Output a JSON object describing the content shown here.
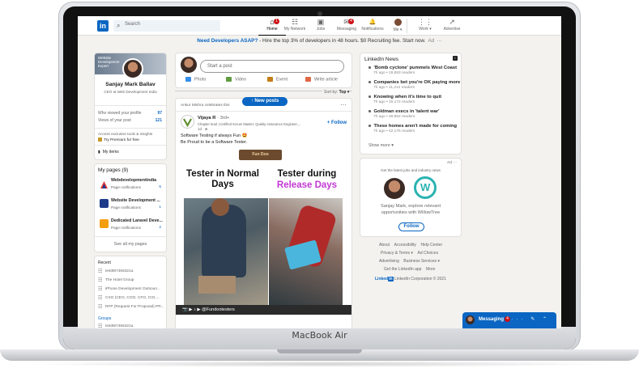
{
  "device": {
    "label": "MacBook Air"
  },
  "nav": {
    "logo": "in",
    "search_placeholder": "Search",
    "items": [
      {
        "label": "Home",
        "glyph": "⌂",
        "badge": "1"
      },
      {
        "label": "My Network",
        "glyph": "☷",
        "badge": ""
      },
      {
        "label": "Jobs",
        "glyph": "▣",
        "badge": ""
      },
      {
        "label": "Messaging",
        "glyph": "✉",
        "badge": "4"
      },
      {
        "label": "Notifications",
        "glyph": "🔔",
        "badge": ""
      },
      {
        "label": "Me ▾",
        "glyph": "",
        "badge": ""
      },
      {
        "label": "Work ▾",
        "glyph": "⋮⋮",
        "badge": ""
      },
      {
        "label": "Advertise",
        "glyph": "↗",
        "badge": ""
      }
    ]
  },
  "adline": {
    "link": "Need Developers ASAP?",
    "text": " - Hire the top 3% of developers in 48 hours. $0 Recruiting fee. Start now.",
    "ad": "Ad",
    "dots": "···"
  },
  "profile": {
    "cover_text": "Website Development Expert",
    "name": "Sanjay Mark Ballav",
    "headline": "CEO at Web Development India",
    "viewed_label": "Who viewed your profile",
    "viewed_value": "97",
    "views_label": "Views of your post",
    "views_value": "121",
    "premium_line1": "Access exclusive tools & insights",
    "premium_line2": "Try Premium for free",
    "my_items": "My items"
  },
  "pages": {
    "title": "My pages (9)",
    "items": [
      {
        "name": "Webdevelopmentindia",
        "sub": "Page notifications",
        "count": "5",
        "color": "#e53935"
      },
      {
        "name": "Website Development ...",
        "sub": "Page notifications",
        "count": "1",
        "color": "#1e3a8a"
      },
      {
        "name": "Dedicated Laravel Deve...",
        "sub": "Page notifications",
        "count": "2",
        "color": "#f59e0b"
      }
    ],
    "see_all": "See all my pages"
  },
  "recent": {
    "title": "Recent",
    "items": [
      "test987456321a",
      "The Hotel Group",
      "iPhone Development Outsoun...",
      "CXO (CEO, COO, CFO, CIO,...",
      "RFP (Request For Proposal) PR..."
    ],
    "groups_title": "Groups",
    "groups_items": [
      "test987456321a"
    ]
  },
  "share": {
    "start_post": "Start a post",
    "actions": [
      {
        "label": "Photo",
        "color": "#378fe9"
      },
      {
        "label": "Video",
        "color": "#5f9b41"
      },
      {
        "label": "Event",
        "color": "#c37d16"
      },
      {
        "label": "Write article",
        "color": "#e06847"
      }
    ]
  },
  "sort": {
    "label": "Sort by:",
    "value": "Top ▾"
  },
  "new_posts": "↑ New posts",
  "post": {
    "celebrates": "Ankur Mishra celebrates this",
    "dots": "···",
    "author": "Vijaya R",
    "degree": " · 3rd+",
    "author_sub": "Chapter lead ,Certified Scrum Master, Quality Assurance Engineer,...",
    "time": "1d · ⊕",
    "follow": "+ Follow",
    "text1": "Software Testing if always Fun 🤩",
    "text2": "Be Proud to be a Software Tester.",
    "fun_badge": "Fun Doo",
    "left_heading": "Tester in Normal Days",
    "right_heading_1": "Tester during",
    "right_heading_2": "Release Days",
    "footer": "📷 ▶ ♪ ▶ @Fundootesters"
  },
  "news": {
    "title": "LinkedIn News",
    "items": [
      {
        "headline": "'Bomb cyclone' pummels West Coast",
        "meta": "7h ago • 19,893 readers"
      },
      {
        "headline": "Companies bet you're OK paying more",
        "meta": "7h ago • 11,212 readers"
      },
      {
        "headline": "Knowing when it's time to quit",
        "meta": "7h ago • 16,172 readers"
      },
      {
        "headline": "Goldman execs in 'talent war'",
        "meta": "7h ago • 48,862 readers"
      },
      {
        "headline": "These homes aren't made for coming",
        "meta": "7h ago • 42,176 readers"
      }
    ],
    "show_more": "Show more ▾"
  },
  "ad_card": {
    "ad": "Ad ···",
    "tagline": "Get the latest jobs and industry news",
    "text1": "Sanjay Mark, explore relevant",
    "text2": "opportunities with WillowTree",
    "follow": "Follow",
    "logo_letter": "W"
  },
  "footer": {
    "row1": [
      "About",
      "Accessibility",
      "Help Center"
    ],
    "row2": [
      "Privacy & Terms ▾",
      "Ad Choices"
    ],
    "row3": [
      "Advertising",
      "Business Services ▾"
    ],
    "row4": [
      "Get the LinkedIn app",
      "More"
    ],
    "brand_a": "Linked",
    "brand_b": "in",
    "copyright": "LinkedIn Corporation © 2021"
  },
  "messaging": {
    "label": "Messaging",
    "badge": "4",
    "icons": "··· ✎ ⌃"
  }
}
